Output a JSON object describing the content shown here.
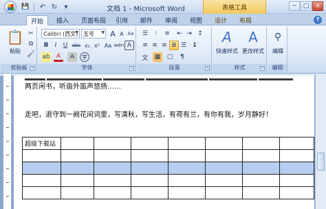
{
  "window": {
    "title": "文档 1 - Microsoft Word",
    "contextual_group": "表格工具",
    "controls": {
      "minimize": "─",
      "maximize": "□",
      "close": "×"
    }
  },
  "quick_access": [
    {
      "icon": "save-icon",
      "glyph": "💾"
    },
    {
      "icon": "undo-icon",
      "glyph": "↶"
    },
    {
      "icon": "redo-icon",
      "glyph": "↻"
    },
    {
      "icon": "customize-qat-icon",
      "glyph": "▾"
    }
  ],
  "tabs": [
    {
      "label": "开始",
      "active": true
    },
    {
      "label": "插入"
    },
    {
      "label": "页面布局"
    },
    {
      "label": "引用"
    },
    {
      "label": "邮件"
    },
    {
      "label": "审阅"
    },
    {
      "label": "视图"
    },
    {
      "label": "设计",
      "contextual": true
    },
    {
      "label": "布局",
      "contextual": true
    }
  ],
  "ribbon": {
    "clipboard": {
      "label": "剪贴板",
      "paste": "粘贴"
    },
    "font": {
      "label": "字体",
      "font_name": "Calibri (西文)",
      "font_size": "五号",
      "bold": "B",
      "italic": "I",
      "underline": "U",
      "strike": "abc",
      "subscript": "x₂",
      "superscript": "x²",
      "grow": "A",
      "shrink": "A",
      "clear": "Aa",
      "phonetic": "wén",
      "border": "A",
      "color": "A",
      "highlight": "ab",
      "shade": "A",
      "circle": "字"
    },
    "paragraph": {
      "label": "段落"
    },
    "styles": {
      "label": "样式",
      "quick": "快速样式",
      "change": "更改样式"
    },
    "editing": {
      "label": "编辑",
      "btn": "编辑"
    }
  },
  "document": {
    "line1": "两页闲书，听亩外笛声悠扬……",
    "line2": "走吧，退守到一阙花间词里，写清秋，写生活，有荷有兰，有你有我，岁月静好！",
    "table": {
      "rows": [
        [
          "超级下载站",
          "",
          "",
          "",
          "",
          "",
          "",
          ""
        ],
        [
          "",
          "",
          "",
          "",
          "",
          "",
          "",
          ""
        ],
        [
          "",
          "",
          "",
          "",
          "",
          "",
          "",
          ""
        ],
        [
          "",
          "",
          "",
          "",
          "",
          "",
          "",
          ""
        ],
        [
          "",
          "",
          "",
          "",
          "",
          "",
          "",
          ""
        ]
      ],
      "selected_row_index": 2
    }
  },
  "colors": {
    "accent": "#3d75c4",
    "selection": "#b6cff0",
    "contextual": "#f2c95d"
  }
}
